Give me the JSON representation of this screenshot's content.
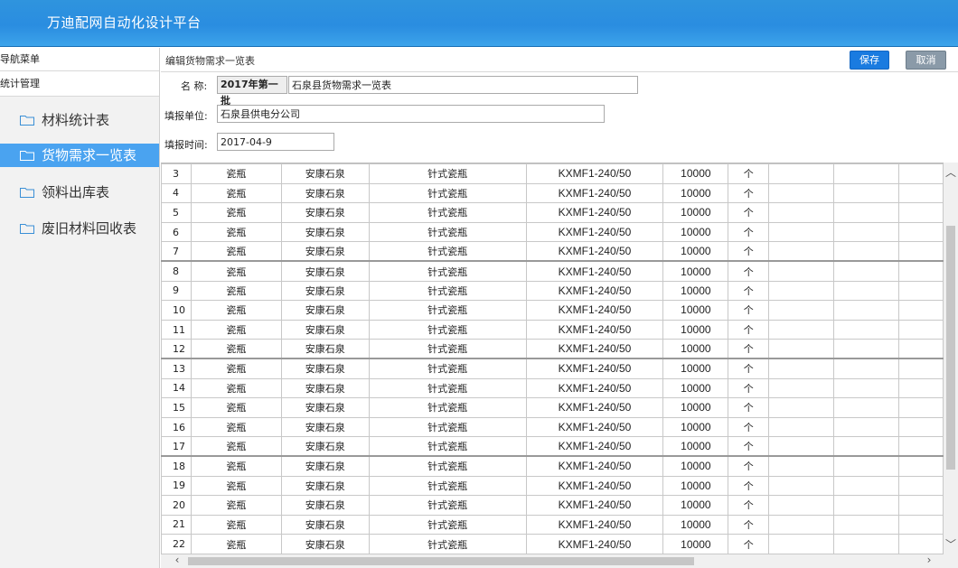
{
  "app": {
    "title": "万迪配网自动化设计平台"
  },
  "sidebar": {
    "title": "导航菜单",
    "group": "统计管理",
    "items": [
      {
        "label": "材料统计表",
        "icon": "folder-icon",
        "active": false
      },
      {
        "label": "货物需求一览表",
        "icon": "folder-icon",
        "active": true
      },
      {
        "label": "领料出库表",
        "icon": "folder-icon",
        "active": false
      },
      {
        "label": "废旧材料回收表",
        "icon": "folder-icon",
        "active": false
      }
    ]
  },
  "main": {
    "breadcrumb": "编辑货物需求一览表",
    "save_label": "保存",
    "cancel_label": "取消",
    "form": {
      "name_label": "名 称:",
      "name_prefix": "2017年第一批",
      "name_value": "石泉县货物需求一览表",
      "unit_label": "填报单位:",
      "unit_value": "石泉县供电分公司",
      "date_label": "填报时间:",
      "date_value": "2017-04-9"
    },
    "table": {
      "rows": [
        [
          "3",
          "瓷瓶",
          "安康石泉",
          "针式瓷瓶",
          "KXMF1-240/50",
          "10000",
          "个"
        ],
        [
          "4",
          "瓷瓶",
          "安康石泉",
          "针式瓷瓶",
          "KXMF1-240/50",
          "10000",
          "个"
        ],
        [
          "5",
          "瓷瓶",
          "安康石泉",
          "针式瓷瓶",
          "KXMF1-240/50",
          "10000",
          "个"
        ],
        [
          "6",
          "瓷瓶",
          "安康石泉",
          "针式瓷瓶",
          "KXMF1-240/50",
          "10000",
          "个"
        ],
        [
          "7",
          "瓷瓶",
          "安康石泉",
          "针式瓷瓶",
          "KXMF1-240/50",
          "10000",
          "个"
        ],
        [
          "8",
          "瓷瓶",
          "安康石泉",
          "针式瓷瓶",
          "KXMF1-240/50",
          "10000",
          "个"
        ],
        [
          "9",
          "瓷瓶",
          "安康石泉",
          "针式瓷瓶",
          "KXMF1-240/50",
          "10000",
          "个"
        ],
        [
          "10",
          "瓷瓶",
          "安康石泉",
          "针式瓷瓶",
          "KXMF1-240/50",
          "10000",
          "个"
        ],
        [
          "11",
          "瓷瓶",
          "安康石泉",
          "针式瓷瓶",
          "KXMF1-240/50",
          "10000",
          "个"
        ],
        [
          "12",
          "瓷瓶",
          "安康石泉",
          "针式瓷瓶",
          "KXMF1-240/50",
          "10000",
          "个"
        ],
        [
          "13",
          "瓷瓶",
          "安康石泉",
          "针式瓷瓶",
          "KXMF1-240/50",
          "10000",
          "个"
        ],
        [
          "14",
          "瓷瓶",
          "安康石泉",
          "针式瓷瓶",
          "KXMF1-240/50",
          "10000",
          "个"
        ],
        [
          "15",
          "瓷瓶",
          "安康石泉",
          "针式瓷瓶",
          "KXMF1-240/50",
          "10000",
          "个"
        ],
        [
          "16",
          "瓷瓶",
          "安康石泉",
          "针式瓷瓶",
          "KXMF1-240/50",
          "10000",
          "个"
        ],
        [
          "17",
          "瓷瓶",
          "安康石泉",
          "针式瓷瓶",
          "KXMF1-240/50",
          "10000",
          "个"
        ],
        [
          "18",
          "瓷瓶",
          "安康石泉",
          "针式瓷瓶",
          "KXMF1-240/50",
          "10000",
          "个"
        ],
        [
          "19",
          "瓷瓶",
          "安康石泉",
          "针式瓷瓶",
          "KXMF1-240/50",
          "10000",
          "个"
        ],
        [
          "20",
          "瓷瓶",
          "安康石泉",
          "针式瓷瓶",
          "KXMF1-240/50",
          "10000",
          "个"
        ],
        [
          "21",
          "瓷瓶",
          "安康石泉",
          "针式瓷瓶",
          "KXMF1-240/50",
          "10000",
          "个"
        ],
        [
          "22",
          "瓷瓶",
          "安康石泉",
          "针式瓷瓶",
          "KXMF1-240/50",
          "10000",
          "个"
        ]
      ]
    },
    "scroll_icons": {
      "up": "chevron-up-icon",
      "down": "chevron-down-icon",
      "left": "chevron-left-icon",
      "right": "chevron-right-icon"
    }
  },
  "colors": {
    "header": "#2a8de0",
    "active_item": "#4aa3f0",
    "save_button": "#1a7be0",
    "cancel_button": "#8a9aa8"
  }
}
